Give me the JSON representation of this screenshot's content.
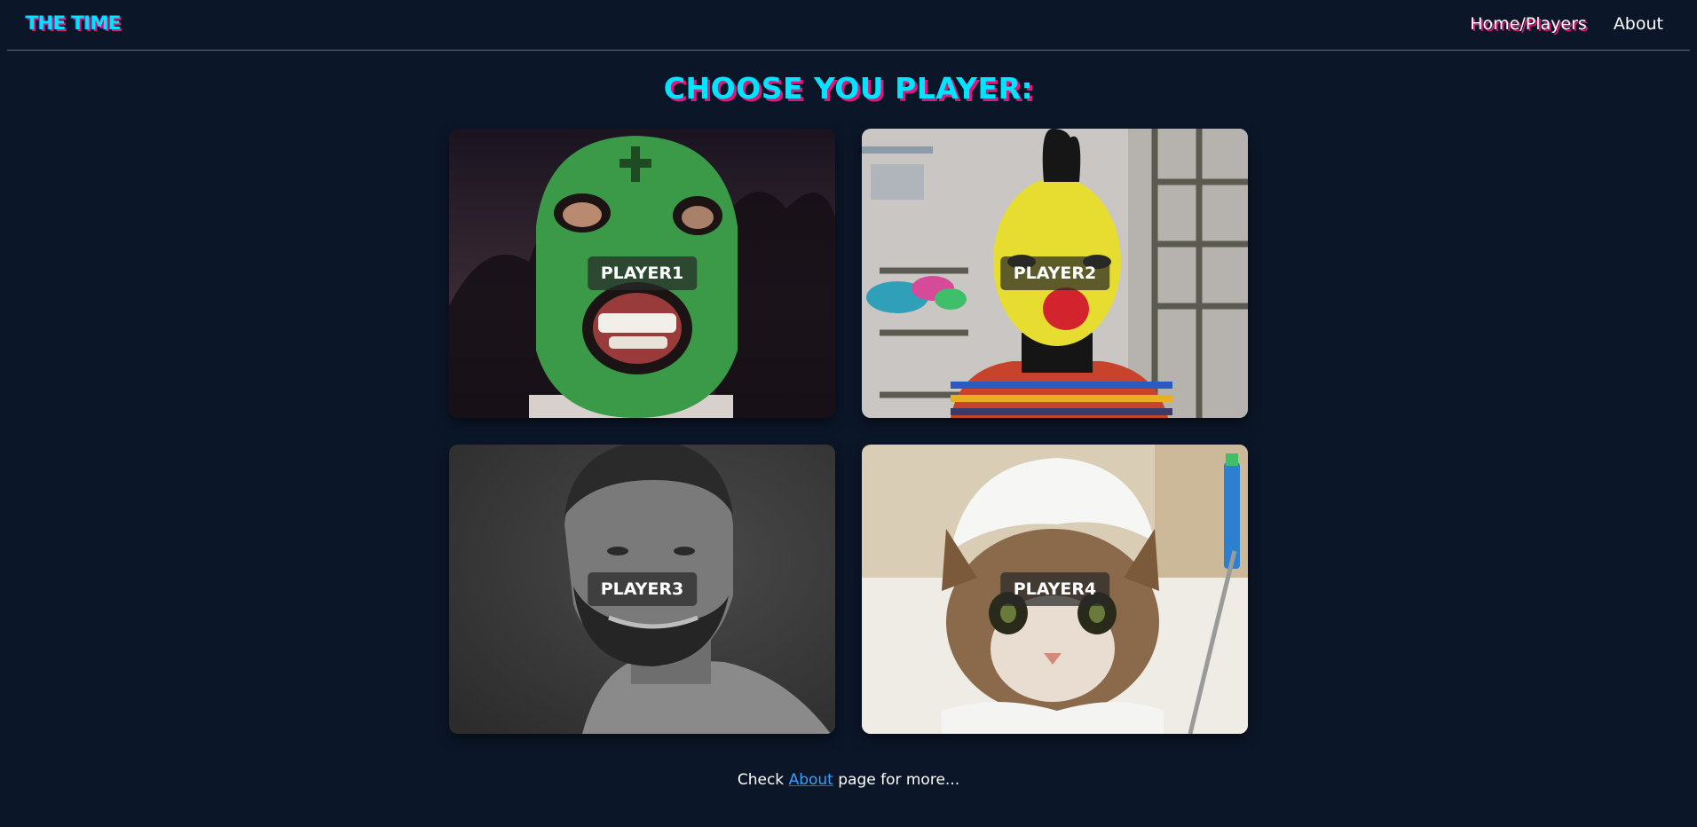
{
  "header": {
    "logo": "THE TIME",
    "nav": [
      {
        "label": "Home/Players",
        "active": true
      },
      {
        "label": "About",
        "active": false
      }
    ]
  },
  "main": {
    "title": "CHOOSE YOU PLAYER:",
    "players": [
      {
        "label": "PLAYER1",
        "image": "green-ski-mask-man"
      },
      {
        "label": "PLAYER2",
        "image": "yellow-face-clown-man"
      },
      {
        "label": "PLAYER3",
        "image": "bearded-man-grayscale"
      },
      {
        "label": "PLAYER4",
        "image": "wet-cat-with-foam"
      }
    ]
  },
  "footer": {
    "prefix": "Check ",
    "link": "About",
    "suffix": " page for more..."
  },
  "colors": {
    "background": "#0b1628",
    "accent_cyan": "#00e5ff",
    "accent_magenta": "#e0187c",
    "link_blue": "#3aa0ff"
  }
}
